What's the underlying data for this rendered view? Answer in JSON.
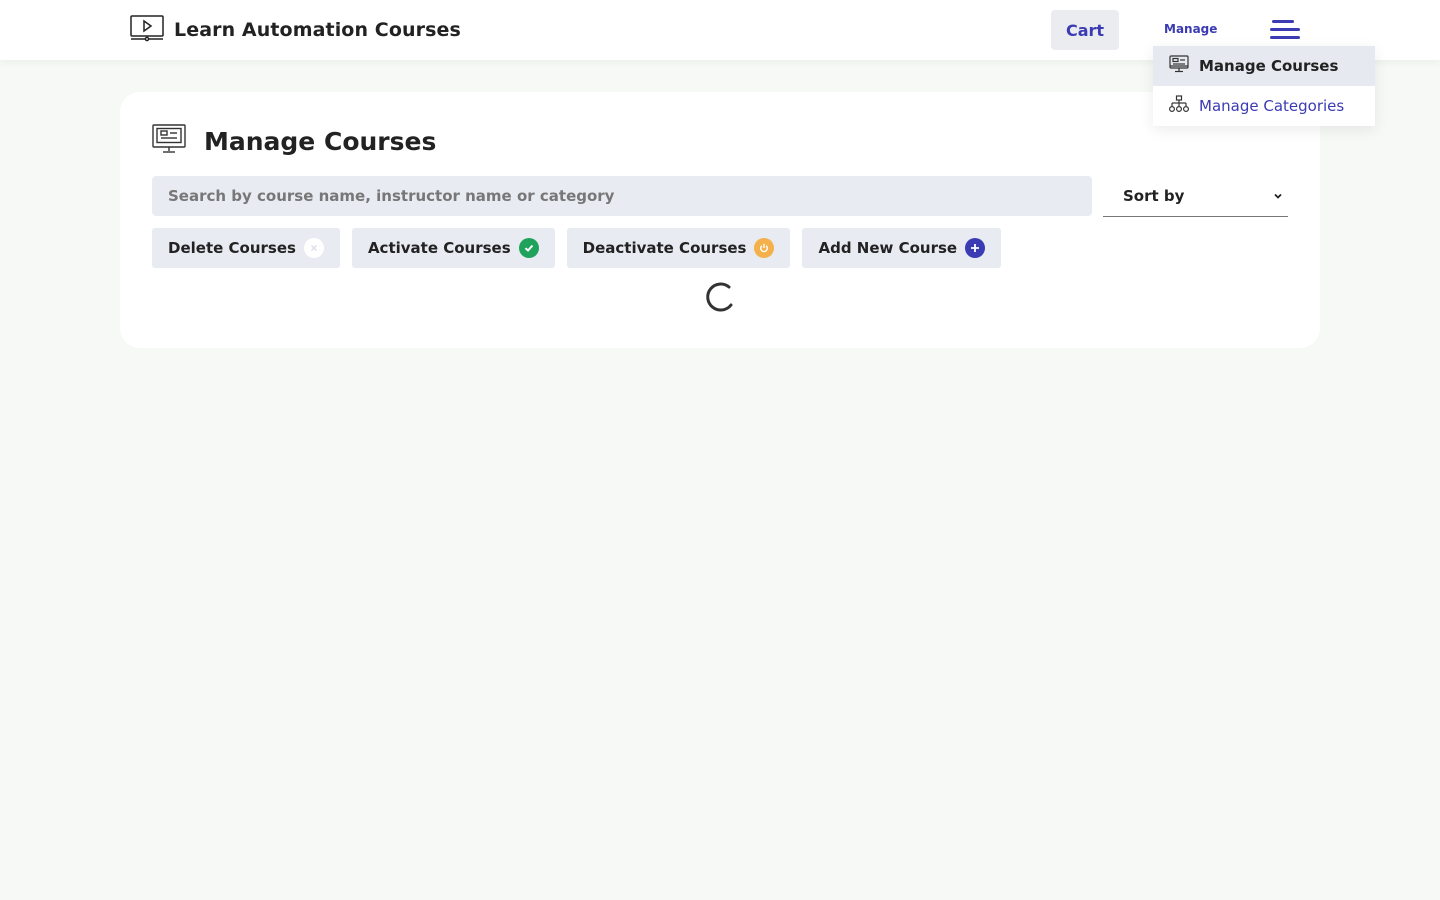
{
  "header": {
    "brand_title": "Learn Automation Courses",
    "cart_label": "Cart",
    "manage_label": "Manage",
    "brand_icon": "video-monitor-icon",
    "menu_icon": "hamburger-menu-icon"
  },
  "dropdown": {
    "items": [
      {
        "label": "Manage Courses",
        "icon": "monitor-icon",
        "active": true
      },
      {
        "label": "Manage Categories",
        "icon": "sitemap-icon",
        "active": false
      }
    ]
  },
  "main": {
    "title": "Manage Courses",
    "title_icon": "monitor-icon",
    "search_placeholder": "Search by course name, instructor name or category",
    "sort_label": "Sort by",
    "actions": [
      {
        "label": "Delete Courses",
        "icon": "close-circle-icon",
        "color": "#ffffff"
      },
      {
        "label": "Activate Courses",
        "icon": "check-circle-icon",
        "color": "#1fa35b"
      },
      {
        "label": "Deactivate Courses",
        "icon": "power-circle-icon",
        "color": "#f4b04a"
      },
      {
        "label": "Add New Course",
        "icon": "plus-circle-icon",
        "color": "#3b3bb3"
      }
    ]
  },
  "colors": {
    "accent": "#3b3bb3",
    "background": "#f7f9f7",
    "input_bg": "#e8ebf2"
  }
}
